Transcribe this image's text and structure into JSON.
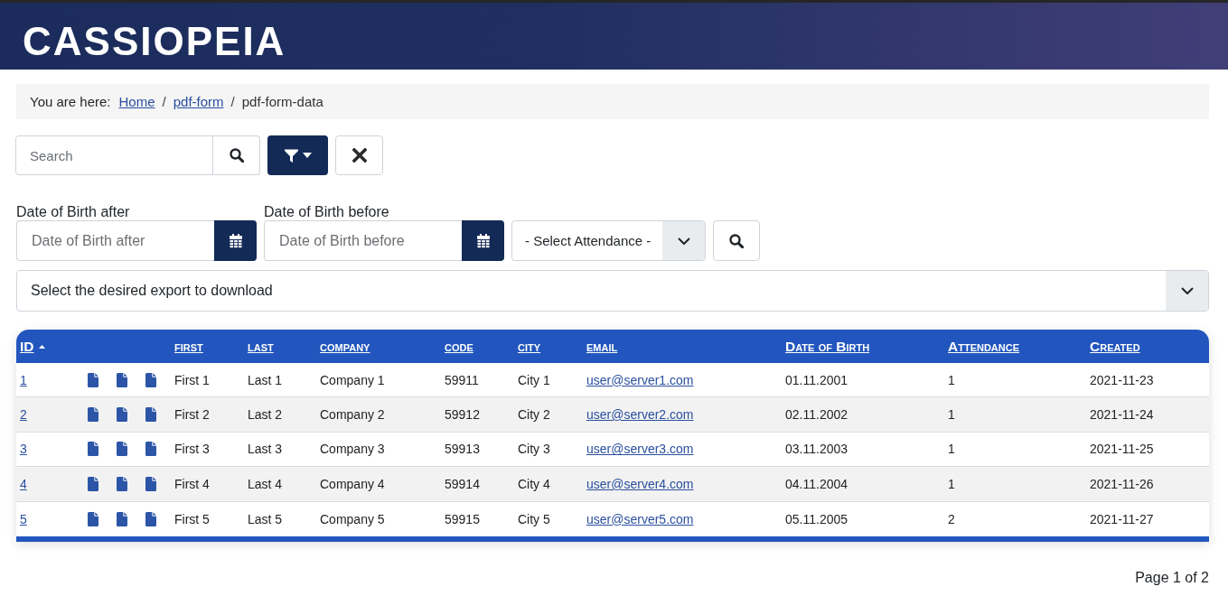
{
  "header": {
    "logo": "CASSIOPEIA"
  },
  "breadcrumb": {
    "prefix": "You are here:",
    "items": [
      {
        "kind": "link",
        "label": "Home"
      },
      {
        "kind": "separator",
        "label": "/"
      },
      {
        "kind": "link",
        "label": "pdf-form"
      },
      {
        "kind": "separator",
        "label": "/"
      },
      {
        "kind": "current",
        "label": "pdf-form-data"
      }
    ]
  },
  "toolbar": {
    "search": {
      "placeholder": "Search"
    }
  },
  "filters": {
    "date_fields": [
      {
        "label": "Date of Birth after",
        "placeholder": "Date of Birth after"
      },
      {
        "label": "Date of Birth before",
        "placeholder": "Date of Birth before"
      }
    ],
    "attendance_select": {
      "value": "- Select Attendance -"
    }
  },
  "export_select": {
    "value": "Select the desired export to download"
  },
  "table": {
    "columns": [
      {
        "label": "ID",
        "sorted": true
      },
      {
        "label": "first",
        "sorted": false
      },
      {
        "label": "last",
        "sorted": false
      },
      {
        "label": "company",
        "sorted": false
      },
      {
        "label": "code",
        "sorted": false
      },
      {
        "label": "city",
        "sorted": false
      },
      {
        "label": "email",
        "sorted": false
      },
      {
        "label": "Date of Birth",
        "sorted": false
      },
      {
        "label": "Attendance",
        "sorted": false
      },
      {
        "label": "Created",
        "sorted": false
      }
    ],
    "rows": [
      {
        "id": "1",
        "first": "First 1",
        "last": "Last 1",
        "company": "Company 1",
        "code": "59911",
        "city": "City 1",
        "email": "user@server1.com",
        "date_of_birth": "01.11.2001",
        "attendance": "1",
        "created": "2021-11-23"
      },
      {
        "id": "2",
        "first": "First 2",
        "last": "Last 2",
        "company": "Company 2",
        "code": "59912",
        "city": "City 2",
        "email": "user@server2.com",
        "date_of_birth": "02.11.2002",
        "attendance": "1",
        "created": "2021-11-24"
      },
      {
        "id": "3",
        "first": "First 3",
        "last": "Last 3",
        "company": "Company 3",
        "code": "59913",
        "city": "City 3",
        "email": "user@server3.com",
        "date_of_birth": "03.11.2003",
        "attendance": "1",
        "created": "2021-11-25"
      },
      {
        "id": "4",
        "first": "First 4",
        "last": "Last 4",
        "company": "Company 4",
        "code": "59914",
        "city": "City 4",
        "email": "user@server4.com",
        "date_of_birth": "04.11.2004",
        "attendance": "1",
        "created": "2021-11-26"
      },
      {
        "id": "5",
        "first": "First 5",
        "last": "Last 5",
        "company": "Company 5",
        "code": "59915",
        "city": "City 5",
        "email": "user@server5.com",
        "date_of_birth": "05.11.2005",
        "attendance": "2",
        "created": "2021-11-27"
      }
    ]
  },
  "pagination": {
    "text": "Page 1 of 2"
  }
}
